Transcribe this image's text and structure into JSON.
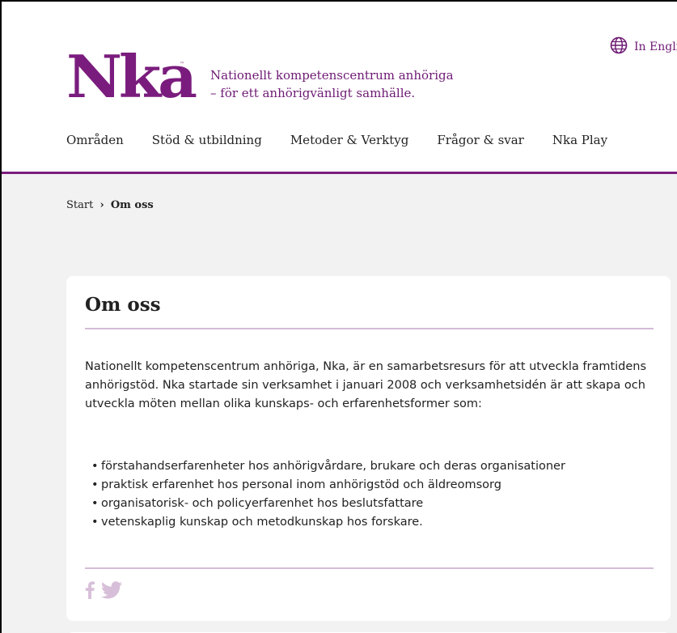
{
  "header": {
    "language_link": "In English",
    "logo_text": "Nka",
    "tagline_line1": "Nationellt kompetenscentrum anhöriga",
    "tagline_line2": "– för ett anhörigvänligt samhälle."
  },
  "nav": {
    "items": [
      {
        "label": "Områden"
      },
      {
        "label": "Stöd & utbildning"
      },
      {
        "label": "Metoder & Verktyg"
      },
      {
        "label": "Frågor & svar"
      },
      {
        "label": "Nka Play"
      }
    ]
  },
  "breadcrumb": {
    "home": "Start",
    "separator": "›",
    "current": "Om oss"
  },
  "article": {
    "title": "Om oss",
    "intro": "Nationellt kompetenscentrum anhöriga, Nka, är en samarbetsresurs för att utveckla framtidens anhörigstöd. Nka startade sin verksamhet i januari 2008 och verksamhetsidén är att skapa och utveckla möten mellan olika kunskaps- och erfarenhetsformer som:",
    "bullets": [
      "förstahandserfarenheter hos anhörigvårdare, brukare och deras organisationer",
      "praktisk erfarenhet hos personal inom anhörigstöd och äldreomsorg",
      "organisatorisk- och policyerfarenhet hos beslutsfattare",
      "vetenskaplig kunskap och metodkunskap hos forskare."
    ]
  },
  "social": {
    "icons": [
      "facebook-icon",
      "twitter-icon"
    ],
    "color": "#d8bfd9"
  },
  "colors": {
    "brand": "#7a1c7d",
    "content_bg": "#f2f2f2",
    "rule": "#d4bcd6"
  }
}
